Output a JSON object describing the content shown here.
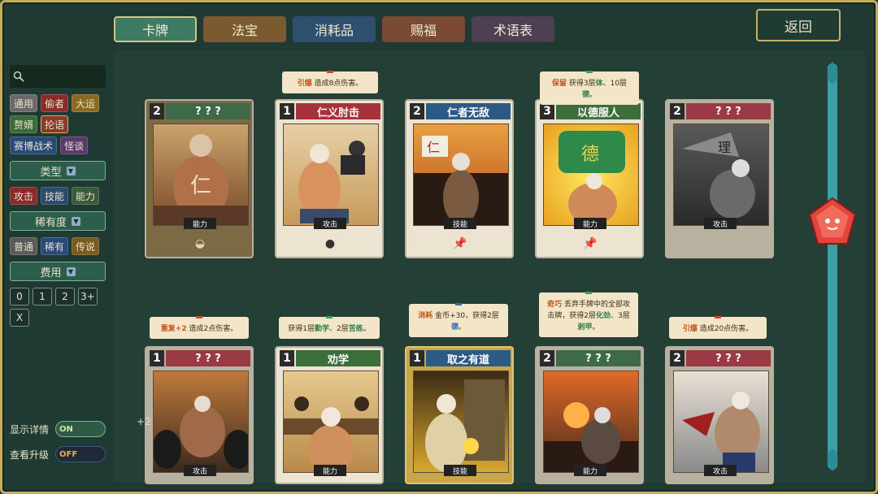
{
  "tabs": [
    {
      "label": "卡牌",
      "color": "#3f7a64",
      "active": true
    },
    {
      "label": "法宝",
      "color": "#7a5a2e"
    },
    {
      "label": "消耗品",
      "color": "#2f4f6e"
    },
    {
      "label": "赐福",
      "color": "#7a4a34"
    },
    {
      "label": "术语表",
      "color": "#4d4052"
    }
  ],
  "back_label": "返回",
  "sidebar": {
    "tags": [
      {
        "label": "通用",
        "color": "#6a6a6a"
      },
      {
        "label": "偷者",
        "color": "#8a2a2a"
      },
      {
        "label": "大运",
        "color": "#8a6a1e"
      },
      {
        "label": "赘婿",
        "color": "#3a6a3a"
      },
      {
        "label": "抡语",
        "color": "#8a3a2e"
      },
      {
        "label": "赛博战术",
        "color": "#2a4a7a"
      },
      {
        "label": "怪谈",
        "color": "#5a3a6e"
      }
    ],
    "type_title": "类型",
    "types": [
      {
        "label": "攻击",
        "color": "#8a2a2a"
      },
      {
        "label": "技能",
        "color": "#2a4a6e"
      },
      {
        "label": "能力",
        "color": "#3a5a3a"
      }
    ],
    "rarity_title": "稀有度",
    "rarities": [
      {
        "label": "普通",
        "color": "#5a5a5a"
      },
      {
        "label": "稀有",
        "color": "#2a4a7a"
      },
      {
        "label": "传说",
        "color": "#7a5a1e"
      }
    ],
    "cost_title": "费用",
    "costs": [
      "0",
      "1",
      "2",
      "3+",
      "X"
    ],
    "show_details_label": "显示详情",
    "show_details_value": "ON",
    "view_upgrade_label": "查看升级",
    "view_upgrade_value": "OFF"
  },
  "cards": [
    {
      "cost": "2",
      "title": "? ? ?",
      "title_color": "#3e6a4a",
      "type": "能力",
      "dim": true
    },
    {
      "cost": "1",
      "title": "仁义肘击",
      "title_color": "#a8323a",
      "type": "攻击"
    },
    {
      "cost": "2",
      "title": "仁者无敌",
      "title_color": "#2c5a86",
      "type": "技能"
    },
    {
      "cost": "3",
      "title": "以德服人",
      "title_color": "#3c6e3c",
      "type": "能力"
    },
    {
      "cost": "2",
      "title": "? ? ?",
      "title_color": "#9a3a44",
      "type": "攻击",
      "dim": true
    },
    {
      "cost": "1",
      "title": "? ? ?",
      "title_color": "#9a3a44",
      "type": "攻击",
      "dim": true
    },
    {
      "cost": "1",
      "title": "劝学",
      "title_color": "#3c6e3c",
      "type": "能力"
    },
    {
      "cost": "1",
      "title": "取之有道",
      "title_color": "#2c5a86",
      "type": "技能",
      "gold": true
    },
    {
      "cost": "2",
      "title": "? ? ?",
      "title_color": "#3e6a4a",
      "type": "能力",
      "dim": true
    },
    {
      "cost": "2",
      "title": "? ? ?",
      "title_color": "#9a3a44",
      "type": "攻击",
      "dim": true
    }
  ],
  "tooltips": {
    "t1_kw": "引爆",
    "t1_text": "造成8点伤害。",
    "t3_kw": "保留",
    "t3_a": "获得3层",
    "t3_b": "体",
    "t3_c": "、10层",
    "t3_d": "德",
    "t3_e": "。",
    "t5_kw": "重复+2",
    "t5_text": "造成2点伤害。",
    "t6_a": "获得1层",
    "t6_b": "勤学",
    "t6_c": "、2层",
    "t6_d": "苦练",
    "t6_e": "。",
    "t7_kw": "消耗",
    "t7_a": "金币+30，获得2层",
    "t7_b": "德",
    "t7_c": "。",
    "t8_kw": "奇巧",
    "t8_a": "丢弃手牌中的全部攻击牌，获得2层",
    "t8_b": "化劲",
    "t8_c": "、3层",
    "t8_d": "剥甲",
    "t8_e": "。",
    "t9_kw": "引爆",
    "t9_text": "造成20点伤害。"
  },
  "plus_label": "+2"
}
